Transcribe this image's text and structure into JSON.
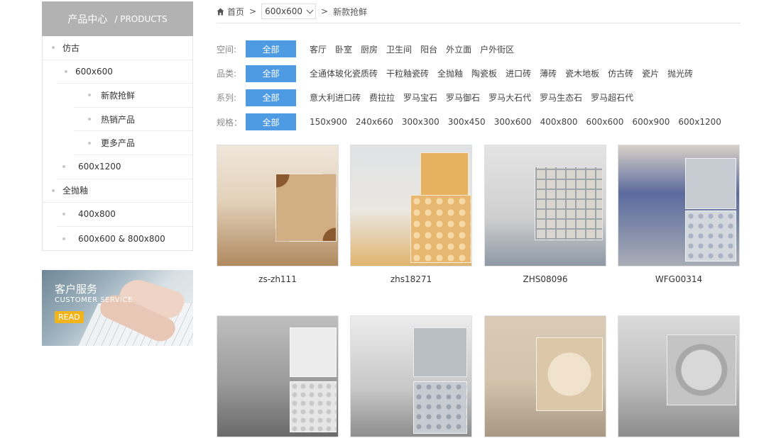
{
  "sidebar": {
    "title_cn": "产品中心",
    "title_en": "/ PRODUCTS",
    "items": [
      {
        "label": "仿古"
      },
      {
        "label": "600x600"
      },
      {
        "label": "新款抢鲜"
      },
      {
        "label": "热销产品"
      },
      {
        "label": "更多产品"
      },
      {
        "label": "600x1200"
      },
      {
        "label": "全抛釉"
      },
      {
        "label": "400x800"
      },
      {
        "label": "600x600 & 800x800"
      }
    ]
  },
  "service_banner": {
    "title": "客户服务",
    "subtitle": "CUSTOMER SERVICE",
    "button": "READ"
  },
  "breadcrumb": {
    "home": "首页",
    "separator": ">",
    "dropdown_value": "600x600",
    "current": "新款抢鲜"
  },
  "filters": {
    "all_label": "全部",
    "rows": [
      {
        "label": "空间:",
        "options": [
          "客厅",
          "卧室",
          "厨房",
          "卫生间",
          "阳台",
          "外立面",
          "户外街区"
        ]
      },
      {
        "label": "品类:",
        "options": [
          "全通体玻化瓷质砖",
          "干粒釉瓷砖",
          "全抛釉",
          "陶瓷板",
          "进口砖",
          "薄砖",
          "瓷木地板",
          "仿古砖",
          "瓷片",
          "抛光砖"
        ]
      },
      {
        "label": "系列:",
        "options": [
          "意大利进口砖",
          "费拉拉",
          "罗马宝石",
          "罗马御石",
          "罗马大石代",
          "罗马生态石",
          "罗马超石代"
        ]
      },
      {
        "label": "规格：",
        "options": [
          "150x900",
          "240x660",
          "300x300",
          "300x450",
          "300x600",
          "400x800",
          "600x600",
          "600x900",
          "600x1200"
        ]
      }
    ]
  },
  "products": [
    {
      "name": "zs-zh111"
    },
    {
      "name": "zhs18271"
    },
    {
      "name": "ZHS08096"
    },
    {
      "name": "WFG00314"
    },
    {
      "name": ""
    },
    {
      "name": ""
    },
    {
      "name": ""
    },
    {
      "name": ""
    }
  ],
  "colors": {
    "accent": "#4f9be3",
    "sidebar_header": "#b2b2b2",
    "read_button": "#f2b41c"
  }
}
